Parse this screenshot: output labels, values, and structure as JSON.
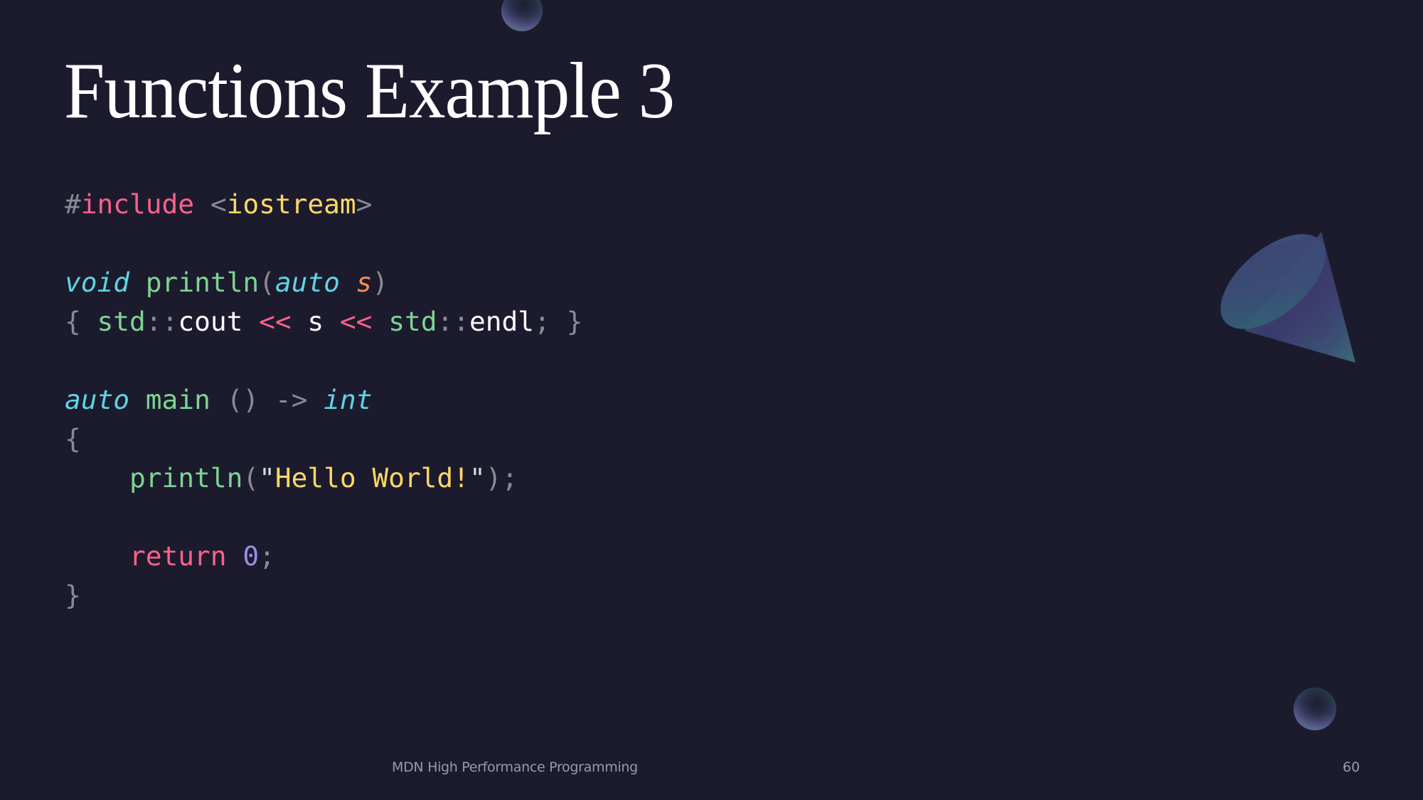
{
  "slide": {
    "title": "Functions Example 3",
    "footer": "MDN High Performance Programming",
    "page_number": "60"
  },
  "code": {
    "language": "cpp",
    "lines": [
      [
        {
          "t": "#",
          "k": "punct"
        },
        {
          "t": "include",
          "k": "keyword"
        },
        {
          "t": " ",
          "k": "plain"
        },
        {
          "t": "<",
          "k": "punct"
        },
        {
          "t": "iostream",
          "k": "string"
        },
        {
          "t": ">",
          "k": "punct"
        }
      ],
      [],
      [
        {
          "t": "void",
          "k": "type"
        },
        {
          "t": " ",
          "k": "plain"
        },
        {
          "t": "println",
          "k": "func"
        },
        {
          "t": "(",
          "k": "punct"
        },
        {
          "t": "auto",
          "k": "type"
        },
        {
          "t": " ",
          "k": "plain"
        },
        {
          "t": "s",
          "k": "param"
        },
        {
          "t": ")",
          "k": "punct"
        }
      ],
      [
        {
          "t": "{",
          "k": "punct"
        },
        {
          "t": " ",
          "k": "plain"
        },
        {
          "t": "std",
          "k": "func"
        },
        {
          "t": "::",
          "k": "punct"
        },
        {
          "t": "cout",
          "k": "plain"
        },
        {
          "t": " ",
          "k": "plain"
        },
        {
          "t": "<<",
          "k": "keyword"
        },
        {
          "t": " s ",
          "k": "plain"
        },
        {
          "t": "<<",
          "k": "keyword"
        },
        {
          "t": " ",
          "k": "plain"
        },
        {
          "t": "std",
          "k": "func"
        },
        {
          "t": "::",
          "k": "punct"
        },
        {
          "t": "endl",
          "k": "plain"
        },
        {
          "t": ";",
          "k": "punct"
        },
        {
          "t": " ",
          "k": "plain"
        },
        {
          "t": "}",
          "k": "punct"
        }
      ],
      [],
      [
        {
          "t": "auto",
          "k": "type"
        },
        {
          "t": " ",
          "k": "plain"
        },
        {
          "t": "main",
          "k": "func"
        },
        {
          "t": " ",
          "k": "plain"
        },
        {
          "t": "()",
          "k": "punct"
        },
        {
          "t": " ",
          "k": "plain"
        },
        {
          "t": "->",
          "k": "punct"
        },
        {
          "t": " ",
          "k": "plain"
        },
        {
          "t": "int",
          "k": "type"
        }
      ],
      [
        {
          "t": "{",
          "k": "punct"
        }
      ],
      [
        {
          "t": "    ",
          "k": "plain"
        },
        {
          "t": "println",
          "k": "func"
        },
        {
          "t": "(",
          "k": "punct"
        },
        {
          "t": "\"",
          "k": "quote"
        },
        {
          "t": "Hello World!",
          "k": "string"
        },
        {
          "t": "\"",
          "k": "quote"
        },
        {
          "t": ");",
          "k": "punct"
        }
      ],
      [],
      [
        {
          "t": "    ",
          "k": "plain"
        },
        {
          "t": "return",
          "k": "keyword"
        },
        {
          "t": " ",
          "k": "plain"
        },
        {
          "t": "0",
          "k": "number"
        },
        {
          "t": ";",
          "k": "punct"
        }
      ],
      [
        {
          "t": "}",
          "k": "punct"
        }
      ]
    ]
  },
  "decorations": {
    "shapes": [
      "sphere-top",
      "cone",
      "sphere-bottom"
    ]
  },
  "colors": {
    "background": "#1c1b2e",
    "title": "#ffffff",
    "punct": "#8a8a96",
    "keyword": "#ff6188",
    "string": "#ffd866",
    "type": "#5fd4e3",
    "func": "#7ed491",
    "param": "#f98e52",
    "number": "#9b8ee6",
    "plain": "#fcfcfa",
    "footer": "#9a9aa6"
  }
}
